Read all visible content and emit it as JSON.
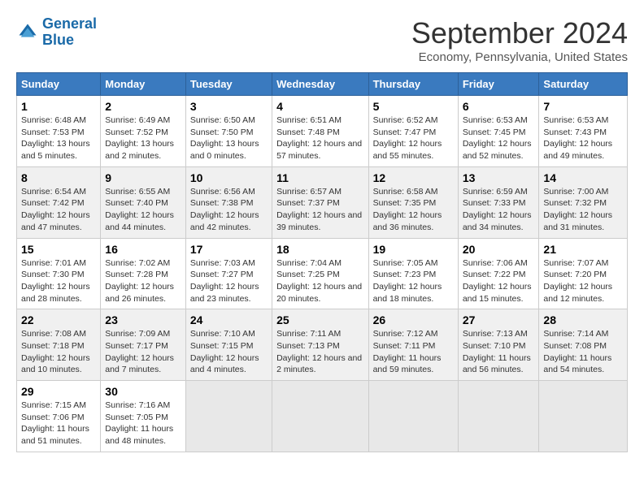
{
  "logo": {
    "line1": "General",
    "line2": "Blue"
  },
  "title": "September 2024",
  "subtitle": "Economy, Pennsylvania, United States",
  "days_of_week": [
    "Sunday",
    "Monday",
    "Tuesday",
    "Wednesday",
    "Thursday",
    "Friday",
    "Saturday"
  ],
  "weeks": [
    [
      {
        "day": "1",
        "sunrise": "6:48 AM",
        "sunset": "7:53 PM",
        "daylight": "13 hours and 5 minutes."
      },
      {
        "day": "2",
        "sunrise": "6:49 AM",
        "sunset": "7:52 PM",
        "daylight": "13 hours and 2 minutes."
      },
      {
        "day": "3",
        "sunrise": "6:50 AM",
        "sunset": "7:50 PM",
        "daylight": "13 hours and 0 minutes."
      },
      {
        "day": "4",
        "sunrise": "6:51 AM",
        "sunset": "7:48 PM",
        "daylight": "12 hours and 57 minutes."
      },
      {
        "day": "5",
        "sunrise": "6:52 AM",
        "sunset": "7:47 PM",
        "daylight": "12 hours and 55 minutes."
      },
      {
        "day": "6",
        "sunrise": "6:53 AM",
        "sunset": "7:45 PM",
        "daylight": "12 hours and 52 minutes."
      },
      {
        "day": "7",
        "sunrise": "6:53 AM",
        "sunset": "7:43 PM",
        "daylight": "12 hours and 49 minutes."
      }
    ],
    [
      {
        "day": "8",
        "sunrise": "6:54 AM",
        "sunset": "7:42 PM",
        "daylight": "12 hours and 47 minutes."
      },
      {
        "day": "9",
        "sunrise": "6:55 AM",
        "sunset": "7:40 PM",
        "daylight": "12 hours and 44 minutes."
      },
      {
        "day": "10",
        "sunrise": "6:56 AM",
        "sunset": "7:38 PM",
        "daylight": "12 hours and 42 minutes."
      },
      {
        "day": "11",
        "sunrise": "6:57 AM",
        "sunset": "7:37 PM",
        "daylight": "12 hours and 39 minutes."
      },
      {
        "day": "12",
        "sunrise": "6:58 AM",
        "sunset": "7:35 PM",
        "daylight": "12 hours and 36 minutes."
      },
      {
        "day": "13",
        "sunrise": "6:59 AM",
        "sunset": "7:33 PM",
        "daylight": "12 hours and 34 minutes."
      },
      {
        "day": "14",
        "sunrise": "7:00 AM",
        "sunset": "7:32 PM",
        "daylight": "12 hours and 31 minutes."
      }
    ],
    [
      {
        "day": "15",
        "sunrise": "7:01 AM",
        "sunset": "7:30 PM",
        "daylight": "12 hours and 28 minutes."
      },
      {
        "day": "16",
        "sunrise": "7:02 AM",
        "sunset": "7:28 PM",
        "daylight": "12 hours and 26 minutes."
      },
      {
        "day": "17",
        "sunrise": "7:03 AM",
        "sunset": "7:27 PM",
        "daylight": "12 hours and 23 minutes."
      },
      {
        "day": "18",
        "sunrise": "7:04 AM",
        "sunset": "7:25 PM",
        "daylight": "12 hours and 20 minutes."
      },
      {
        "day": "19",
        "sunrise": "7:05 AM",
        "sunset": "7:23 PM",
        "daylight": "12 hours and 18 minutes."
      },
      {
        "day": "20",
        "sunrise": "7:06 AM",
        "sunset": "7:22 PM",
        "daylight": "12 hours and 15 minutes."
      },
      {
        "day": "21",
        "sunrise": "7:07 AM",
        "sunset": "7:20 PM",
        "daylight": "12 hours and 12 minutes."
      }
    ],
    [
      {
        "day": "22",
        "sunrise": "7:08 AM",
        "sunset": "7:18 PM",
        "daylight": "12 hours and 10 minutes."
      },
      {
        "day": "23",
        "sunrise": "7:09 AM",
        "sunset": "7:17 PM",
        "daylight": "12 hours and 7 minutes."
      },
      {
        "day": "24",
        "sunrise": "7:10 AM",
        "sunset": "7:15 PM",
        "daylight": "12 hours and 4 minutes."
      },
      {
        "day": "25",
        "sunrise": "7:11 AM",
        "sunset": "7:13 PM",
        "daylight": "12 hours and 2 minutes."
      },
      {
        "day": "26",
        "sunrise": "7:12 AM",
        "sunset": "7:11 PM",
        "daylight": "11 hours and 59 minutes."
      },
      {
        "day": "27",
        "sunrise": "7:13 AM",
        "sunset": "7:10 PM",
        "daylight": "11 hours and 56 minutes."
      },
      {
        "day": "28",
        "sunrise": "7:14 AM",
        "sunset": "7:08 PM",
        "daylight": "11 hours and 54 minutes."
      }
    ],
    [
      {
        "day": "29",
        "sunrise": "7:15 AM",
        "sunset": "7:06 PM",
        "daylight": "11 hours and 51 minutes."
      },
      {
        "day": "30",
        "sunrise": "7:16 AM",
        "sunset": "7:05 PM",
        "daylight": "11 hours and 48 minutes."
      },
      null,
      null,
      null,
      null,
      null
    ]
  ],
  "labels": {
    "sunrise": "Sunrise: ",
    "sunset": "Sunset: ",
    "daylight": "Daylight: "
  }
}
